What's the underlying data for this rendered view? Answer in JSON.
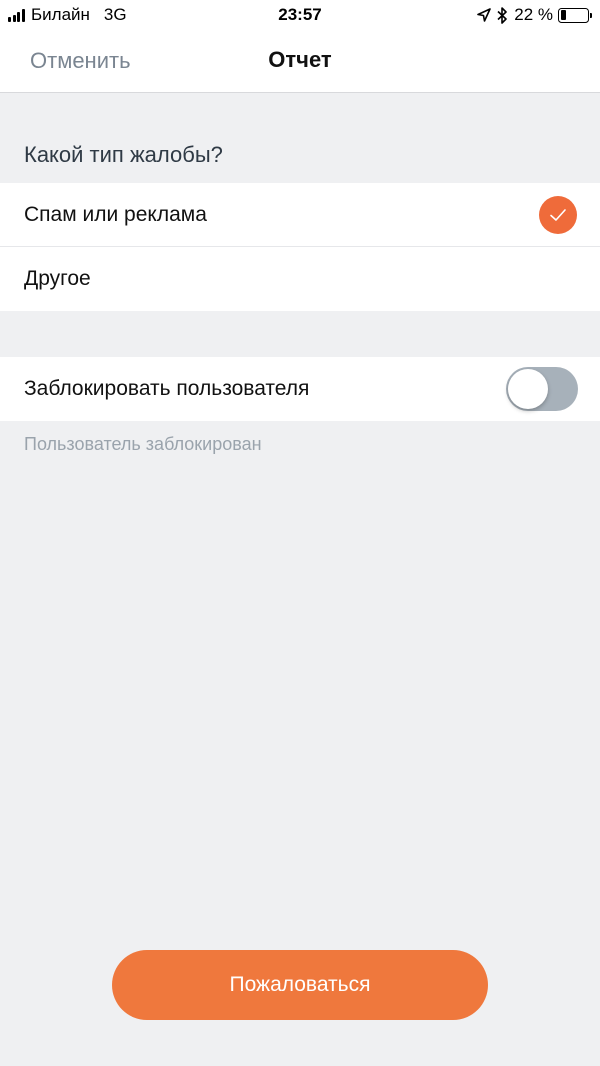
{
  "status_bar": {
    "carrier": "Билайн",
    "network": "3G",
    "time": "23:57",
    "battery_text": "22 %",
    "battery_level": 0.22,
    "icons": [
      "signal-icon",
      "location-arrow-icon",
      "bluetooth-icon",
      "battery-icon"
    ]
  },
  "nav": {
    "cancel_label": "Отменить",
    "title": "Отчет"
  },
  "complaint": {
    "header": "Какой тип жалобы?",
    "options": [
      {
        "label": "Спам или реклама",
        "selected": true
      },
      {
        "label": "Другое",
        "selected": false
      }
    ]
  },
  "block": {
    "label": "Заблокировать пользователя",
    "enabled": false,
    "note": "Пользователь заблокирован"
  },
  "submit": {
    "label": "Пожаловаться"
  },
  "colors": {
    "accent": "#ef6b3a",
    "button": "#ef783d",
    "background": "#eff0f2",
    "toggle_off": "#a7b1ba"
  }
}
